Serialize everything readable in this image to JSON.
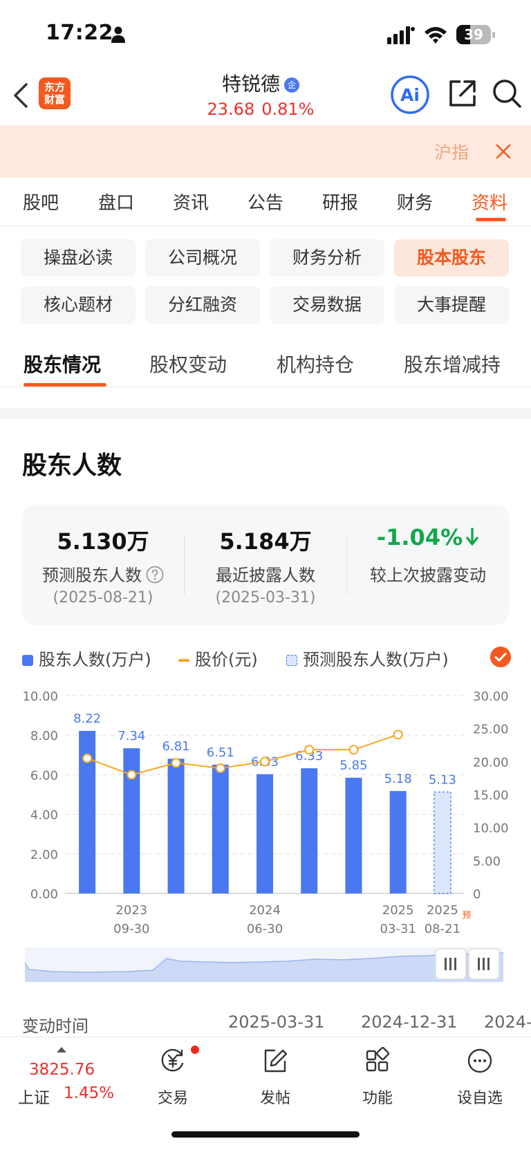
{
  "status_bar": {
    "time": "17:22",
    "battery": "39",
    "battery_level": 0.39
  },
  "header": {
    "logo_line1": "东方",
    "logo_line2": "财富",
    "stock_name": "特锐德",
    "stock_badge": "企",
    "price": "23.68",
    "change_pct": "0.81%",
    "ai_label": "Ai"
  },
  "banner": {
    "text": "沪指"
  },
  "main_tabs": [
    "股吧",
    "盘口",
    "资讯",
    "公告",
    "研报",
    "财务",
    "资料"
  ],
  "chips": [
    "操盘必读",
    "公司概况",
    "财务分析",
    "股本股东",
    "核心题材",
    "分红融资",
    "交易数据",
    "大事提醒"
  ],
  "sub_tabs": [
    "股东情况",
    "股权变动",
    "机构持仓",
    "股东增减持"
  ],
  "section_title": "股东人数",
  "stats": [
    {
      "value": "5.130万",
      "label": "预测股东人数",
      "date": "(2025-08-21)"
    },
    {
      "value": "5.184万",
      "label": "最近披露人数",
      "date": "(2025-03-31)"
    },
    {
      "value": "-1.04%",
      "label": "较上次披露变动",
      "date": ""
    }
  ],
  "legend": [
    "股东人数(万户)",
    "股价(元)",
    "预测股东人数(万户)"
  ],
  "colors": {
    "accent": "#f25a1f",
    "bar": "#4a78f0",
    "price_line": "#f5a623",
    "down": "#11a84a",
    "up": "#e9302d"
  },
  "chart_data": {
    "type": "bar",
    "categories": [
      "c1",
      "c2",
      "c3",
      "c4",
      "c5",
      "c6",
      "c7",
      "c8",
      "c9"
    ],
    "series": [
      {
        "name": "股东人数(万户)",
        "values": [
          8.22,
          7.34,
          6.81,
          6.51,
          6.03,
          6.33,
          5.85,
          5.18,
          null
        ]
      },
      {
        "name": "预测股东人数(万户)",
        "values": [
          null,
          null,
          null,
          null,
          null,
          null,
          null,
          null,
          5.13
        ]
      },
      {
        "name": "股价(元)",
        "axis": "right",
        "values": [
          20.5,
          18.0,
          19.8,
          19.0,
          20.0,
          21.8,
          21.8,
          24.1,
          null
        ]
      }
    ],
    "bar_labels": [
      "8.22",
      "7.34",
      "6.81",
      "6.51",
      "6.03",
      "6.33",
      "5.85",
      "5.18",
      "5.13"
    ],
    "x_tick_labels": [
      {
        "index": 1,
        "year": "2023",
        "date": "09-30"
      },
      {
        "index": 4,
        "year": "2024",
        "date": "06-30"
      },
      {
        "index": 7,
        "year": "2025",
        "date": "03-31"
      },
      {
        "index": 8,
        "year": "2025",
        "date": "08-21"
      }
    ],
    "forecast_mark": "预",
    "left_ticks": [
      "0.00",
      "2.00",
      "4.00",
      "6.00",
      "8.00",
      "10.00"
    ],
    "right_ticks": [
      "0",
      "5.00",
      "10.00",
      "15.00",
      "20.00",
      "25.00",
      "30.00"
    ],
    "ylim_left": [
      0,
      10
    ],
    "ylim_right": [
      0,
      30
    ],
    "grid": true,
    "legend_position": "top"
  },
  "change_row": {
    "label": "变动时间",
    "dates": [
      "2025-03-31",
      "2024-12-31",
      "2024-"
    ]
  },
  "bottom_nav": {
    "index_value": "3825.76",
    "index_name": "上证",
    "index_pct": "1.45%",
    "items": [
      "交易",
      "发帖",
      "功能",
      "设自选"
    ]
  }
}
